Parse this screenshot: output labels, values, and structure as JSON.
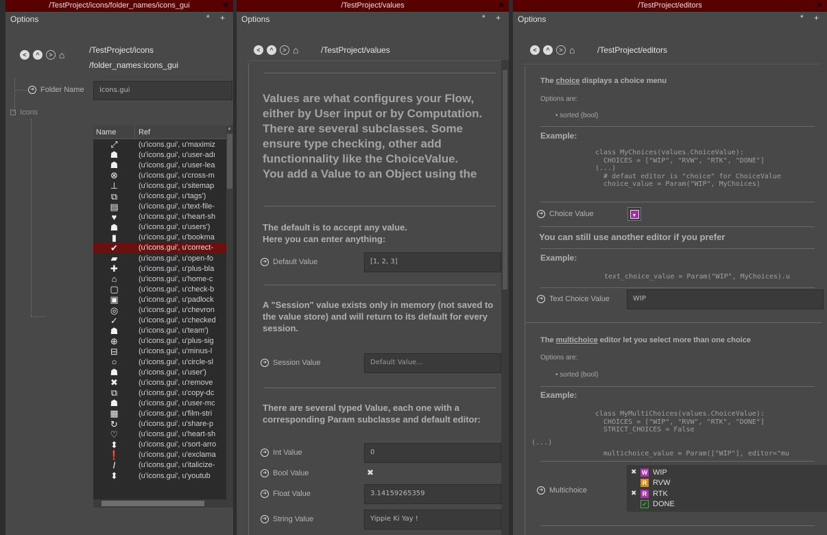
{
  "left": {
    "tab_title": "/TestProject/icons/folder_names/icons_gui",
    "options": "Options",
    "ctl": "* +",
    "path1": "/TestProject/icons",
    "path2": "/folder_names:icons_gui",
    "folder_label": "Folder Name",
    "folder_value": "icons.gui",
    "icons_label": "Icons",
    "table_headers": [
      "Name",
      "Ref"
    ],
    "rows": [
      {
        "icon": "⤢",
        "ref": "(u'icons.gui', u'maximiz"
      },
      {
        "icon": "☗",
        "ref": "(u'icons.gui', u'user-adı"
      },
      {
        "icon": "☗",
        "ref": "(u'icons.gui', u'user-lea"
      },
      {
        "icon": "⊗",
        "ref": "(u'icons.gui', u'cross-m"
      },
      {
        "icon": "⊥",
        "ref": "(u'icons.gui', u'sitemap"
      },
      {
        "icon": "⧉",
        "ref": "(u'icons.gui', u'tags')"
      },
      {
        "icon": "▤",
        "ref": "(u'icons.gui', u'text-file-"
      },
      {
        "icon": "♥",
        "ref": "(u'icons.gui', u'heart-sh"
      },
      {
        "icon": "☗",
        "ref": "(u'icons.gui', u'users')"
      },
      {
        "icon": "▮",
        "ref": "(u'icons.gui', u'bookma"
      },
      {
        "icon": "✔",
        "ref": "(u'icons.gui', u'correct-"
      },
      {
        "icon": "▰",
        "ref": "(u'icons.gui', u'open-fo"
      },
      {
        "icon": "✚",
        "ref": "(u'icons.gui', u'plus-bla"
      },
      {
        "icon": "⌂",
        "ref": "(u'icons.gui', u'home-c"
      },
      {
        "icon": "▢",
        "ref": "(u'icons.gui', u'check-b"
      },
      {
        "icon": "▣",
        "ref": "(u'icons.gui', u'padlock"
      },
      {
        "icon": "◎",
        "ref": "(u'icons.gui', u'chevron"
      },
      {
        "icon": "✓",
        "ref": "(u'icons.gui', u'checked"
      },
      {
        "icon": "☗",
        "ref": "(u'icons.gui', u'team')"
      },
      {
        "icon": "⊕",
        "ref": "(u'icons.gui', u'plus-sig"
      },
      {
        "icon": "⊟",
        "ref": "(u'icons.gui', u'minus-l"
      },
      {
        "icon": "○",
        "ref": "(u'icons.gui', u'circle-sl"
      },
      {
        "icon": "☗",
        "ref": "(u'icons.gui', u'user')"
      },
      {
        "icon": "✖",
        "ref": "(u'icons.gui', u'remove"
      },
      {
        "icon": "⧉",
        "ref": "(u'icons.gui', u'copy-dc"
      },
      {
        "icon": "☗",
        "ref": "(u'icons.gui', u'user-mc"
      },
      {
        "icon": "▦",
        "ref": "(u'icons.gui', u'film-stri"
      },
      {
        "icon": "↻",
        "ref": "(u'icons.gui', u'share-p"
      },
      {
        "icon": "♡",
        "ref": "(u'icons.gui', u'heart-sh"
      },
      {
        "icon": "⬍",
        "ref": "(u'icons.gui', u'sort-arro"
      },
      {
        "icon": "❗",
        "ref": "(u'icons.gui', u'exclama"
      },
      {
        "icon": "𝐼",
        "ref": "(u'icons.gui', u'italicize-"
      },
      {
        "icon": "⬍",
        "ref": "(u'icons.gui', u'youtub"
      }
    ],
    "selected_index": 10
  },
  "mid": {
    "tab_title": "/TestProject/values",
    "options": "Options",
    "ctl": "* +",
    "path": "/TestProject/values",
    "intro": "Values are what configures your Flow, either by User input or by Computation.\nThere are several subclasses. Some ensure type checking, other add functionnality like the ChoiceValue.\nYou add a Value to an Object using the",
    "default_text1": "The default is to accept any value.",
    "default_text2": "Here you can enter anything:",
    "default_label": "Default Value",
    "default_value": "[1, 2, 3]",
    "session_text": "A \"Session\" value exists only in memory (not saved to the value store) and will return to its default for every session.",
    "session_label": "Session Value",
    "session_placeholder": "Default Value...",
    "typed_text": "There are several typed Value, each one with a corresponding Param subclasse and default editor:",
    "int_label": "Int Value",
    "int_value": "0",
    "bool_label": "Bool Value",
    "bool_check": "✖",
    "float_label": "Float Value",
    "float_value": "3.14159265359",
    "string_label": "String Value",
    "string_value": "Yippie Ki Yay !"
  },
  "right": {
    "tab_title": "/TestProject/editors",
    "options": "Options",
    "ctl": "* +",
    "path": "/TestProject/editors",
    "choice_pre": "The ",
    "choice_link": "choice",
    "choice_post": " displays a choice menu",
    "options_are": "Options are:",
    "sorted_bullet": "• sorted (bool)",
    "example": "Example:",
    "code1": "class MyChoices(values.ChoiceValue):\n  CHOICES = [\"WIP\", \"RVW\", \"RTK\", \"DONE\"]\n(...)\n  # defaut editor is \"choice\" for ChoiceValue\n  choice_value = Param(\"WIP\", MyChoices)",
    "choice_label": "Choice Value",
    "other_editor": "You can still use another editor if you prefer",
    "example2": "Example:",
    "code2": "text_choice_value = Param(\"WIP\", MyChoices).u",
    "text_choice_label": "Text Choice Value",
    "text_choice_value": "WIP",
    "multi_pre": "The ",
    "multi_link": "multichoice",
    "multi_post": " editor let you select more than one choice",
    "options_are2": "Options are:",
    "sorted_bullet2": "• sorted (bool)",
    "example3": "Example:",
    "code3": "class MyMultiChoices(values.ChoiceValue):\n  CHOICES = [\"WIP\", \"RVW\", \"RTK\", \"DONE\"]\n  STRICT_CHOICES = False",
    "code3b": "(...)",
    "code3c": "multichoice_value = Param([\"WIP\"], editor=\"mu",
    "multi_label": "Multichoice",
    "multi_items": [
      {
        "letter": "W",
        "label": "WIP",
        "checked": true,
        "color": "#b232b2"
      },
      {
        "letter": "R",
        "label": "RVW",
        "checked": false,
        "color": "#d98a1e"
      },
      {
        "letter": "R",
        "label": "RTK",
        "checked": true,
        "color": "#b232b2"
      },
      {
        "letter": "✔",
        "label": "DONE",
        "checked": false,
        "color": "#3ab53a"
      }
    ],
    "check_glyph": "✖"
  }
}
